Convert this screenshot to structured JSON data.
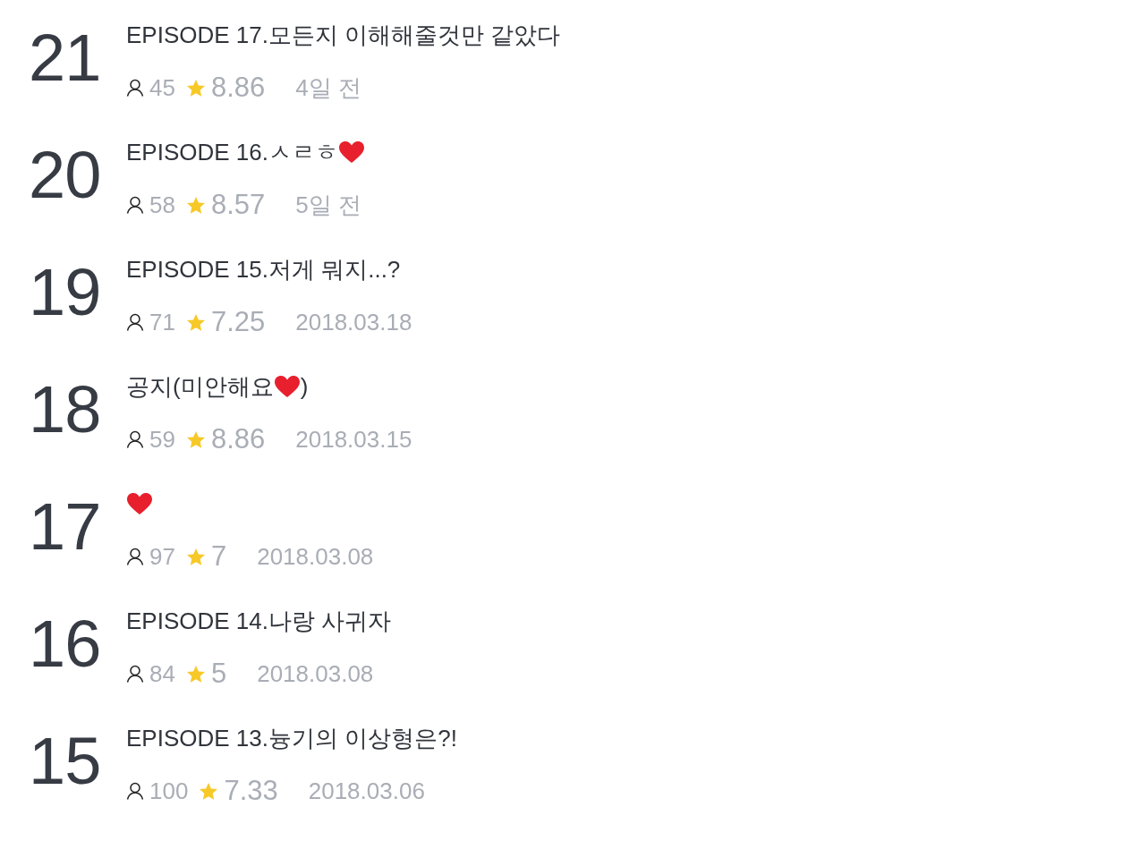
{
  "episodes": [
    {
      "number": "21",
      "title": [
        {
          "kind": "text",
          "text": "EPISODE 17.모든지 이해해줄것만 같았다"
        }
      ],
      "views": "45",
      "rating": "8.86",
      "date": "4일 전"
    },
    {
      "number": "20",
      "title": [
        {
          "kind": "text",
          "text": "EPISODE 16.ㅅㄹㅎ"
        },
        {
          "kind": "heart"
        }
      ],
      "views": "58",
      "rating": "8.57",
      "date": "5일 전"
    },
    {
      "number": "19",
      "title": [
        {
          "kind": "text",
          "text": "EPISODE 15.저게 뭐지...?"
        }
      ],
      "views": "71",
      "rating": "7.25",
      "date": "2018.03.18"
    },
    {
      "number": "18",
      "title": [
        {
          "kind": "text",
          "text": "공지(미안해요"
        },
        {
          "kind": "heart"
        },
        {
          "kind": "text",
          "text": ")"
        }
      ],
      "views": "59",
      "rating": "8.86",
      "date": "2018.03.15"
    },
    {
      "number": "17",
      "title": [
        {
          "kind": "heart"
        }
      ],
      "views": "97",
      "rating": "7",
      "date": "2018.03.08"
    },
    {
      "number": "16",
      "title": [
        {
          "kind": "text",
          "text": "EPISODE 14.나랑 사귀자"
        }
      ],
      "views": "84",
      "rating": "5",
      "date": "2018.03.08"
    },
    {
      "number": "15",
      "title": [
        {
          "kind": "text",
          "text": "EPISODE 13.늉기의 이상형은?!"
        }
      ],
      "views": "100",
      "rating": "7.33",
      "date": "2018.03.06"
    }
  ]
}
